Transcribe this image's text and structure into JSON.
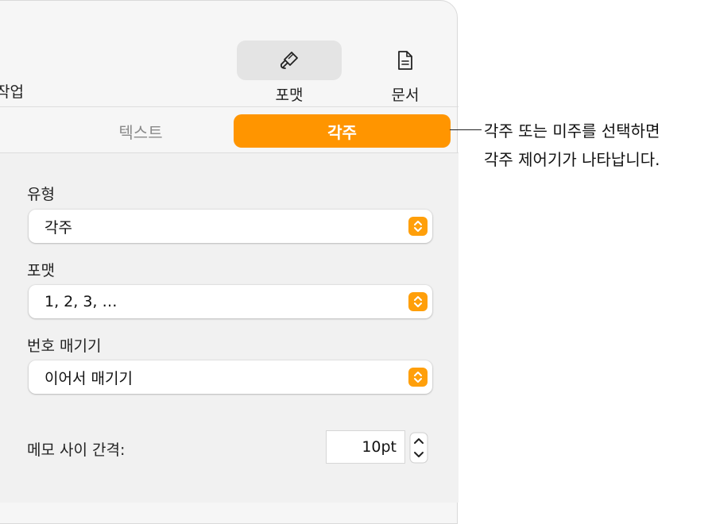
{
  "toolbar": {
    "partial_label": "작업",
    "format_label": "포맷",
    "document_label": "문서"
  },
  "tabs": {
    "text_label": "텍스트",
    "footnotes_label": "각주"
  },
  "fields": {
    "type": {
      "label": "유형",
      "value": "각주"
    },
    "format": {
      "label": "포맷",
      "value": "1, 2, 3, …"
    },
    "numbering": {
      "label": "번호 매기기",
      "value": "이어서 매기기"
    },
    "spacing": {
      "label": "메모 사이 간격:",
      "value": "10pt"
    }
  },
  "callout": {
    "line1": "각주 또는 미주를 선택하면",
    "line2": "각주 제어기가 나타납니다."
  },
  "colors": {
    "accent": "#ff9500",
    "panel_bg": "#f6f6f6"
  },
  "icons": {
    "format": "paintbrush-icon",
    "document": "document-icon",
    "popup": "chevron-up-down-icon",
    "stepper": "stepper-icon"
  }
}
